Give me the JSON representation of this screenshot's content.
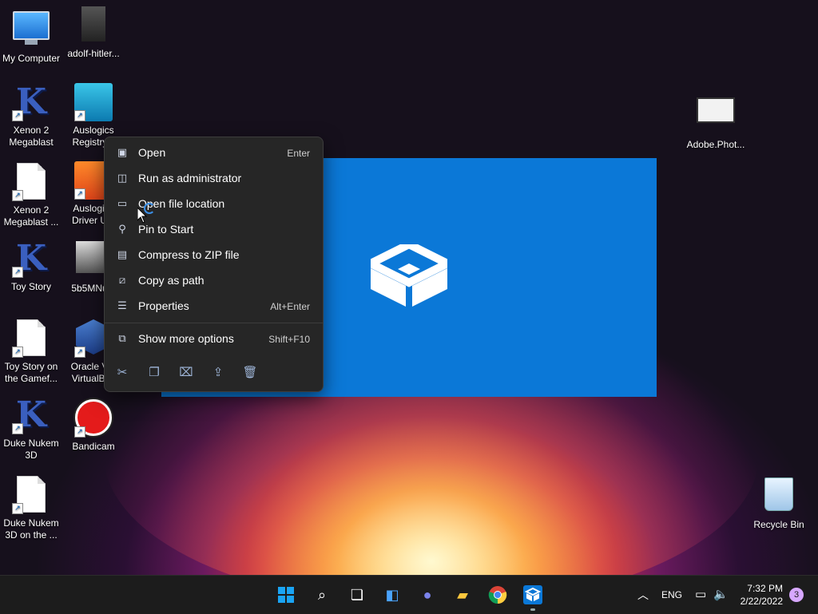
{
  "desktop": {
    "icons": [
      {
        "label": "My Computer"
      },
      {
        "label": "adolf-hitler..."
      },
      {
        "label": "Xenon 2 Megablast"
      },
      {
        "label": "Auslogics Registry..."
      },
      {
        "label": "Xenon 2 Megablast ..."
      },
      {
        "label": "Auslogics Driver U..."
      },
      {
        "label": "Toy Story"
      },
      {
        "label": "5b5MNu..."
      },
      {
        "label": "Toy Story on the Gamef..."
      },
      {
        "label": "Oracle VM VirtualBox"
      },
      {
        "label": "Duke Nukem 3D"
      },
      {
        "label": "Bandicam"
      },
      {
        "label": "Duke Nukem 3D on the ..."
      },
      {
        "label": "Adobe.Phot..."
      },
      {
        "label": "Recycle Bin"
      }
    ]
  },
  "context_menu": {
    "items": [
      {
        "label": "Open",
        "shortcut": "Enter",
        "icon": "open-icon"
      },
      {
        "label": "Run as administrator",
        "shortcut": "",
        "icon": "shield-icon"
      },
      {
        "label": "Open file location",
        "shortcut": "",
        "icon": "folder-icon"
      },
      {
        "label": "Pin to Start",
        "shortcut": "",
        "icon": "pin-icon"
      },
      {
        "label": "Compress to ZIP file",
        "shortcut": "",
        "icon": "zip-icon"
      },
      {
        "label": "Copy as path",
        "shortcut": "",
        "icon": "path-icon"
      },
      {
        "label": "Properties",
        "shortcut": "Alt+Enter",
        "icon": "properties-icon"
      },
      {
        "label": "Show more options",
        "shortcut": "Shift+F10",
        "icon": "more-options-icon"
      }
    ],
    "bottom_actions": [
      "cut-icon",
      "copy-icon",
      "rename-icon",
      "share-icon",
      "delete-icon"
    ]
  },
  "taskbar": {
    "tray_lang": "ENG",
    "clock_time": "7:32 PM",
    "clock_date": "2/22/2022",
    "notification_count": "3"
  }
}
